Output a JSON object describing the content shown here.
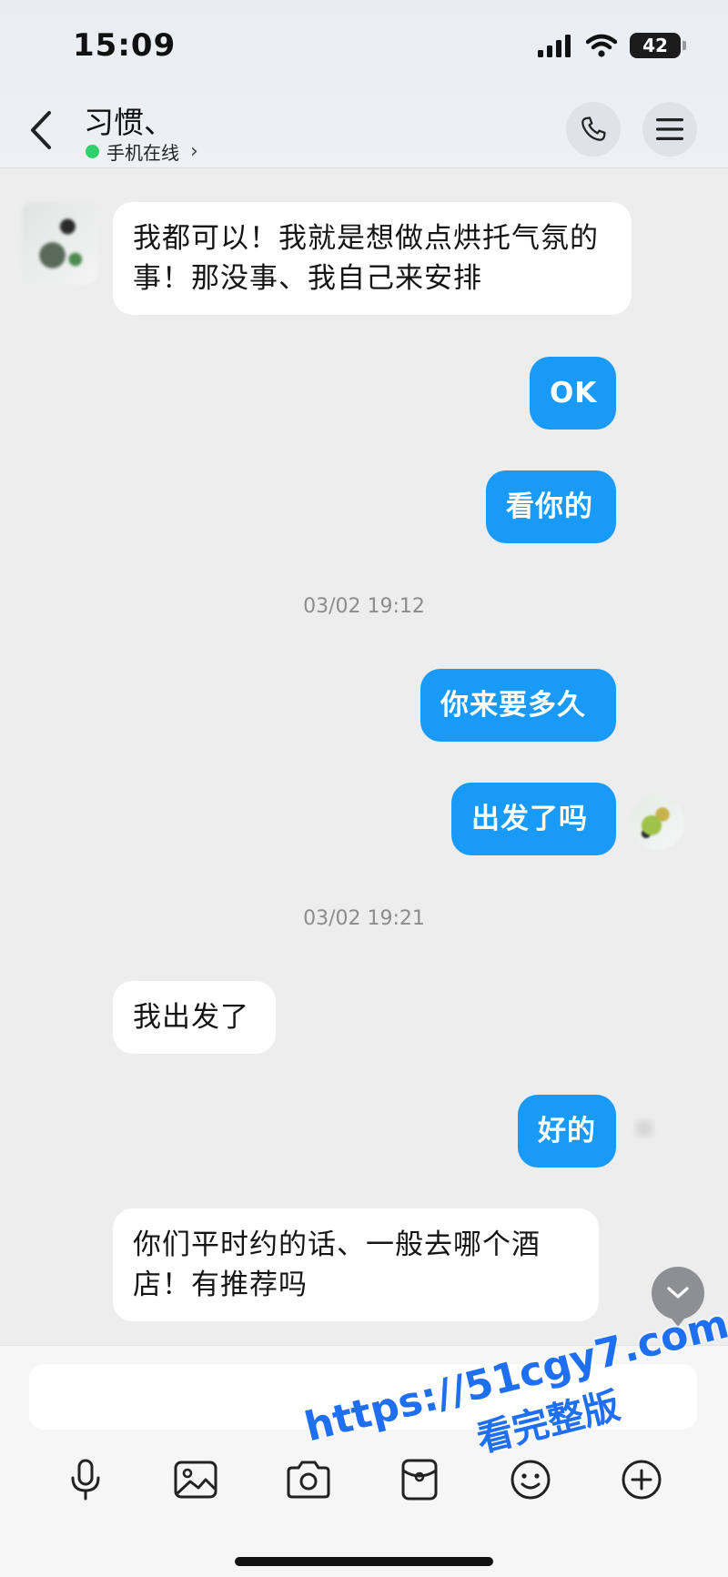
{
  "status_bar": {
    "time": "15:09",
    "battery": "42"
  },
  "header": {
    "title": "习惯、",
    "online_status": "手机在线",
    "chevron": "›"
  },
  "messages": [
    {
      "direction": "in",
      "text": "我都可以！我就是想做点烘托气氛的事！那没事、我自己来安排"
    },
    {
      "direction": "out",
      "text": "OK"
    },
    {
      "direction": "out",
      "text": "看你的"
    },
    {
      "type": "timestamp",
      "text": "03/02 19:12"
    },
    {
      "direction": "out",
      "text": "你来要多久"
    },
    {
      "direction": "out",
      "text": "出发了吗"
    },
    {
      "type": "timestamp",
      "text": "03/02 19:21"
    },
    {
      "direction": "in",
      "text": "我出发了"
    },
    {
      "direction": "out",
      "text": "好的"
    },
    {
      "direction": "in",
      "text": "你们平时约的话、一般去哪个酒店！有推荐吗"
    }
  ],
  "input": {
    "placeholder": ""
  },
  "toolbar": [
    "microphone-icon",
    "image-icon",
    "camera-icon",
    "red-packet-icon",
    "emoji-icon",
    "add-icon"
  ],
  "watermark": {
    "line1": "https://51cgy7.com",
    "line2": "看完整版"
  },
  "colors": {
    "outgoing_bubble": "#1a9af7",
    "incoming_bubble": "#ffffff",
    "background": "#ededed",
    "online_dot": "#2ed16c",
    "watermark": "#1f6ff2"
  }
}
